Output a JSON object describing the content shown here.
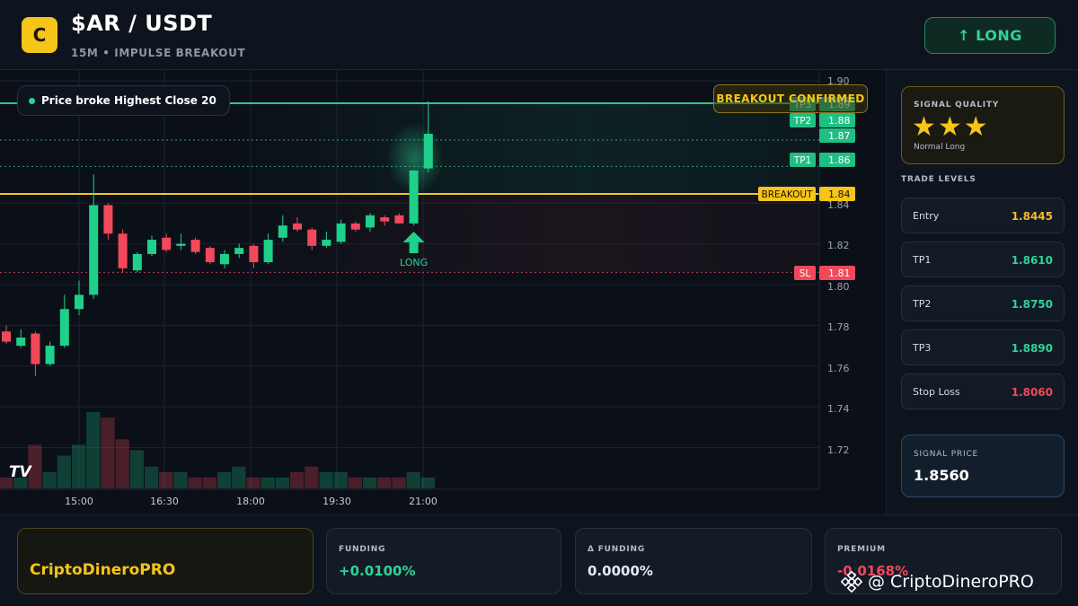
{
  "header": {
    "logo_letter": "C",
    "pair": "$AR / USDT",
    "subtitle": "15M • IMPULSE BREAKOUT",
    "long_button": "↑ LONG"
  },
  "chart": {
    "status_text": "Price broke Highest Close 20",
    "breakout_banner": "BREAKOUT CONFIRMED",
    "tv_logo": "TV",
    "long_marker_label": "LONG",
    "y_ticks": [
      "1.90",
      "1.84",
      "1.82",
      "1.80",
      "1.78",
      "1.76",
      "1.74",
      "1.72"
    ],
    "x_ticks": [
      "15:00",
      "16:30",
      "18:00",
      "19:30",
      "21:00"
    ],
    "level_tags": [
      {
        "name": "TP3",
        "value": "1.89",
        "color": "#1fbf83"
      },
      {
        "name": "TP2",
        "value": "1.88",
        "color": "#1fbf83"
      },
      {
        "name": "",
        "value": "1.87",
        "color": "#1fbf83"
      },
      {
        "name": "TP1",
        "value": "1.86",
        "color": "#1fbf83"
      },
      {
        "name": "BREAKOUT",
        "value": "1.84",
        "color": "#f5c518"
      },
      {
        "name": "SL",
        "value": "1.81",
        "color": "#f2485b"
      }
    ],
    "colors": {
      "up": "#1fd08a",
      "down": "#f2485b",
      "breakout": "#f5c518",
      "tp": "#36c48c"
    }
  },
  "chart_data": {
    "type": "candlestick",
    "interval": "15m",
    "x_ticks": [
      "15:00",
      "16:30",
      "18:00",
      "19:30",
      "21:00"
    ],
    "y_ticks": [
      1.72,
      1.74,
      1.76,
      1.78,
      1.8,
      1.82,
      1.84,
      1.9
    ],
    "levels": {
      "tp3": 1.889,
      "tp2": 1.875,
      "tp1": 1.861,
      "breakout": 1.8445,
      "stop_loss": 1.806
    },
    "candles": [
      {
        "o": 1.777,
        "h": 1.78,
        "l": 1.771,
        "c": 1.772
      },
      {
        "o": 1.77,
        "h": 1.778,
        "l": 1.769,
        "c": 1.774
      },
      {
        "o": 1.776,
        "h": 1.777,
        "l": 1.755,
        "c": 1.761
      },
      {
        "o": 1.761,
        "h": 1.772,
        "l": 1.76,
        "c": 1.77
      },
      {
        "o": 1.77,
        "h": 1.795,
        "l": 1.769,
        "c": 1.788
      },
      {
        "o": 1.788,
        "h": 1.802,
        "l": 1.785,
        "c": 1.795
      },
      {
        "o": 1.795,
        "h": 1.854,
        "l": 1.793,
        "c": 1.839
      },
      {
        "o": 1.839,
        "h": 1.84,
        "l": 1.822,
        "c": 1.825
      },
      {
        "o": 1.825,
        "h": 1.827,
        "l": 1.806,
        "c": 1.808
      },
      {
        "o": 1.807,
        "h": 1.816,
        "l": 1.806,
        "c": 1.815
      },
      {
        "o": 1.815,
        "h": 1.824,
        "l": 1.814,
        "c": 1.822
      },
      {
        "o": 1.823,
        "h": 1.825,
        "l": 1.816,
        "c": 1.817
      },
      {
        "o": 1.819,
        "h": 1.825,
        "l": 1.817,
        "c": 1.82
      },
      {
        "o": 1.822,
        "h": 1.823,
        "l": 1.815,
        "c": 1.816
      },
      {
        "o": 1.818,
        "h": 1.819,
        "l": 1.81,
        "c": 1.811
      },
      {
        "o": 1.81,
        "h": 1.817,
        "l": 1.808,
        "c": 1.815
      },
      {
        "o": 1.815,
        "h": 1.82,
        "l": 1.813,
        "c": 1.818
      },
      {
        "o": 1.819,
        "h": 1.82,
        "l": 1.808,
        "c": 1.811
      },
      {
        "o": 1.811,
        "h": 1.825,
        "l": 1.81,
        "c": 1.822
      },
      {
        "o": 1.823,
        "h": 1.834,
        "l": 1.821,
        "c": 1.829
      },
      {
        "o": 1.83,
        "h": 1.833,
        "l": 1.826,
        "c": 1.827
      },
      {
        "o": 1.827,
        "h": 1.828,
        "l": 1.817,
        "c": 1.819
      },
      {
        "o": 1.819,
        "h": 1.826,
        "l": 1.818,
        "c": 1.822
      },
      {
        "o": 1.821,
        "h": 1.832,
        "l": 1.82,
        "c": 1.83
      },
      {
        "o": 1.83,
        "h": 1.831,
        "l": 1.826,
        "c": 1.827
      },
      {
        "o": 1.828,
        "h": 1.835,
        "l": 1.826,
        "c": 1.834
      },
      {
        "o": 1.833,
        "h": 1.834,
        "l": 1.829,
        "c": 1.831
      },
      {
        "o": 1.834,
        "h": 1.835,
        "l": 1.83,
        "c": 1.83
      },
      {
        "o": 1.83,
        "h": 1.852,
        "l": 1.829,
        "c": 1.856
      },
      {
        "o": 1.857,
        "h": 1.89,
        "l": 1.855,
        "c": 1.874
      }
    ],
    "volumes": [
      2,
      2,
      8,
      3,
      6,
      8,
      14,
      13,
      9,
      7,
      4,
      3,
      3,
      2,
      2,
      3,
      4,
      2,
      2,
      2,
      3,
      4,
      3,
      3,
      2,
      2,
      2,
      2,
      3,
      2
    ]
  },
  "signal_quality": {
    "title": "SIGNAL QUALITY",
    "stars": "★★★",
    "subtitle": "Normal Long"
  },
  "trade_levels": {
    "title": "TRADE LEVELS",
    "rows": [
      {
        "label": "Entry",
        "value": "1.8445",
        "color": "#f5b82e"
      },
      {
        "label": "TP1",
        "value": "1.8610",
        "color": "#2fd39a"
      },
      {
        "label": "TP2",
        "value": "1.8750",
        "color": "#2fd39a"
      },
      {
        "label": "TP3",
        "value": "1.8890",
        "color": "#2fd39a"
      },
      {
        "label": "Stop Loss",
        "value": "1.8060",
        "color": "#f2485b"
      }
    ]
  },
  "signal_price": {
    "title": "SIGNAL PRICE",
    "value": "1.8560"
  },
  "footer": {
    "brand": "CriptoDineroPRO",
    "funding_title": "FUNDING",
    "funding_value": "+0.0100%",
    "funding_color": "#2fd39a",
    "delta_title": "Δ FUNDING",
    "delta_value": "0.0000%",
    "delta_color": "#e6ebf2",
    "premium_title": "PREMIUM",
    "premium_value": "-0.0168%",
    "premium_color": "#f2485b",
    "watermark": "@ CriptoDineroPRO"
  }
}
